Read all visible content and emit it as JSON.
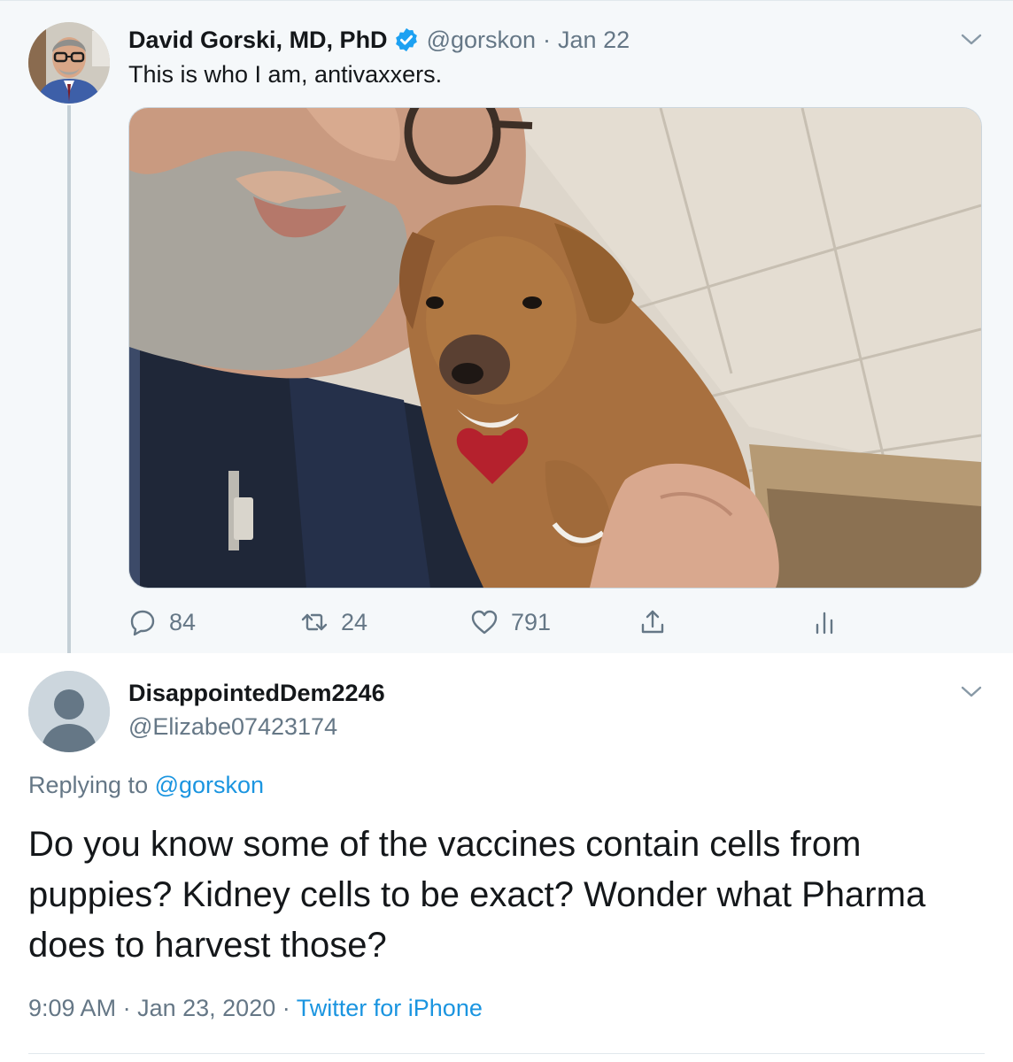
{
  "parent_tweet": {
    "name": "David Gorski, MD, PhD",
    "handle": "@gorskon",
    "separator": "·",
    "date": "Jan 22",
    "text": "This is who I am, antivaxxers.",
    "actions": {
      "reply_count": "84",
      "retweet_count": "24",
      "like_count": "791"
    },
    "icons": [
      "verified-badge-icon",
      "chevron-down-icon",
      "reply-icon",
      "retweet-icon",
      "like-icon",
      "share-icon",
      "analytics-icon"
    ]
  },
  "reply_tweet": {
    "name": "DisappointedDem2246",
    "handle": "@Elizabe07423174",
    "replying_prefix": "Replying to ",
    "replying_mention": "@gorskon",
    "text": "Do you know some of the vaccines contain cells from puppies?   Kidney cells to be exact?   Wonder what Pharma does to harvest those?",
    "time": "9:09 AM",
    "separator": "·",
    "date": "Jan 23, 2020",
    "source": "Twitter for iPhone"
  },
  "colors": {
    "accent": "#1da1f2",
    "link": "#1b95e0",
    "muted_text": "#657786",
    "parent_background": "#f5f8fa"
  }
}
